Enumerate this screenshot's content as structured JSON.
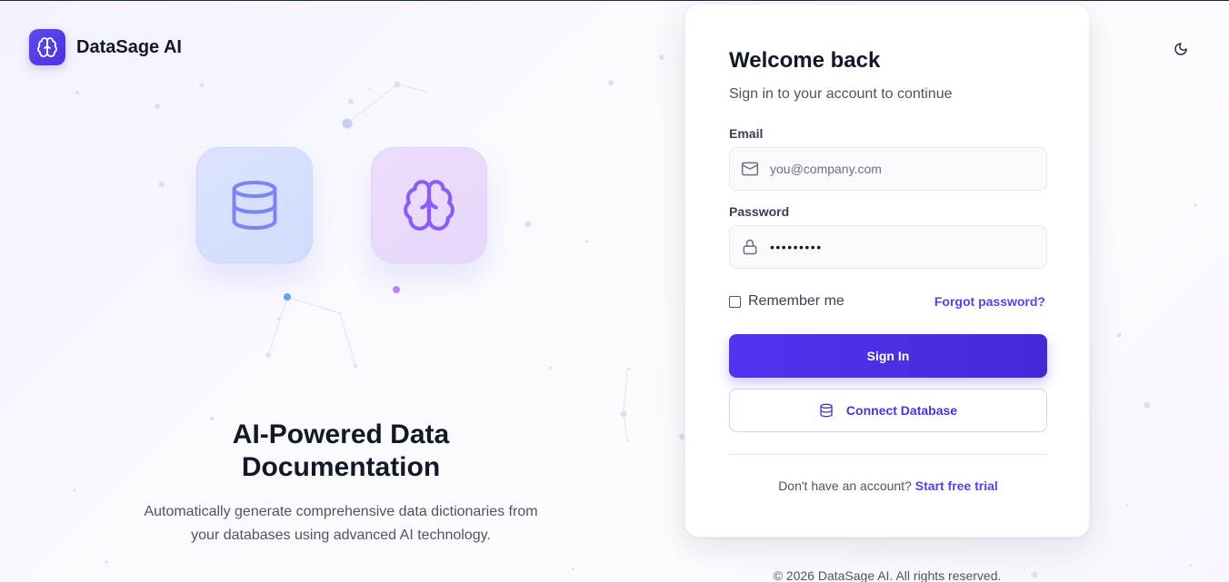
{
  "brand": {
    "name": "DataSage AI",
    "logo_icon": "brain-icon",
    "accent": "#4f46e5"
  },
  "hero": {
    "icons": [
      "database-icon",
      "brain-icon"
    ],
    "title": "AI-Powered Data Documentation",
    "subtitle": "Automatically generate comprehensive data dictionaries from your databases using advanced AI technology."
  },
  "login": {
    "title": "Welcome back",
    "subtitle": "Sign in to your account to continue",
    "email": {
      "label": "Email",
      "placeholder": "you@company.com",
      "value": ""
    },
    "password": {
      "label": "Password",
      "value": "•••••••••"
    },
    "remember_label": "Remember me",
    "remember_checked": false,
    "forgot_label": "Forgot password?",
    "sign_in_label": "Sign In",
    "connect_label": "Connect Database",
    "signup_prompt": "Don't have an account?",
    "signup_link": "Start free trial"
  },
  "footer": {
    "copyright": "© 2026 DataSage AI. All rights reserved."
  },
  "theme_toggle_icon": "moon-icon"
}
